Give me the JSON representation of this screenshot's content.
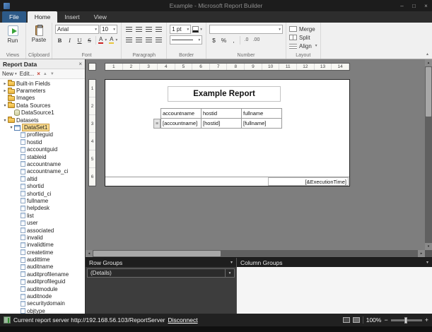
{
  "window": {
    "title": "Example - Microsoft Report Builder"
  },
  "ribbon": {
    "tabs": [
      {
        "label": "File"
      },
      {
        "label": "Home"
      },
      {
        "label": "Insert"
      },
      {
        "label": "View"
      }
    ],
    "views": {
      "label": "Views",
      "run": "Run"
    },
    "clipboard": {
      "label": "Clipboard",
      "paste": "Paste"
    },
    "font": {
      "label": "Font",
      "family": "Arial",
      "size": "10",
      "bold": "B",
      "italic": "I",
      "underline": "U",
      "strike": "S",
      "font_color": "A",
      "highlight": "A"
    },
    "paragraph": {
      "label": "Paragraph"
    },
    "border": {
      "label": "Border",
      "width": "1 pt"
    },
    "number": {
      "label": "Number",
      "currency": "$",
      "percent": "%",
      "comma": ",",
      "dec0": ".0",
      "dec00": ".00"
    },
    "layout": {
      "label": "Layout",
      "merge": "Merge",
      "split": "Split",
      "align": "Align"
    }
  },
  "report_data": {
    "title": "Report Data",
    "toolbar": {
      "new": "New",
      "edit": "Edit..."
    },
    "tree": [
      {
        "label": "Built-in Fields",
        "level": 0,
        "icon": "folder",
        "arrow": "collapsed"
      },
      {
        "label": "Parameters",
        "level": 0,
        "icon": "folder",
        "arrow": "collapsed"
      },
      {
        "label": "Images",
        "level": 0,
        "icon": "folder",
        "arrow": "none"
      },
      {
        "label": "Data Sources",
        "level": 0,
        "icon": "folder",
        "arrow": "expanded"
      },
      {
        "label": "DataSource1",
        "level": 1,
        "icon": "datasource",
        "arrow": "none"
      },
      {
        "label": "Datasets",
        "level": 0,
        "icon": "folder",
        "arrow": "expanded"
      },
      {
        "label": "DataSet1",
        "level": 1,
        "icon": "dataset",
        "arrow": "expanded",
        "selected": true
      },
      {
        "label": "profileguid",
        "level": 2,
        "icon": "field",
        "arrow": "none"
      },
      {
        "label": "hostid",
        "level": 2,
        "icon": "field",
        "arrow": "none"
      },
      {
        "label": "accountguid",
        "level": 2,
        "icon": "field",
        "arrow": "none"
      },
      {
        "label": "stableid",
        "level": 2,
        "icon": "field",
        "arrow": "none"
      },
      {
        "label": "accountname",
        "level": 2,
        "icon": "field",
        "arrow": "none"
      },
      {
        "label": "accountname_ci",
        "level": 2,
        "icon": "field",
        "arrow": "none"
      },
      {
        "label": "altid",
        "level": 2,
        "icon": "field",
        "arrow": "none"
      },
      {
        "label": "shortid",
        "level": 2,
        "icon": "field",
        "arrow": "none"
      },
      {
        "label": "shortid_ci",
        "level": 2,
        "icon": "field",
        "arrow": "none"
      },
      {
        "label": "fullname",
        "level": 2,
        "icon": "field",
        "arrow": "none"
      },
      {
        "label": "helpdesk",
        "level": 2,
        "icon": "field",
        "arrow": "none"
      },
      {
        "label": "list",
        "level": 2,
        "icon": "field",
        "arrow": "none"
      },
      {
        "label": "user",
        "level": 2,
        "icon": "field",
        "arrow": "none"
      },
      {
        "label": "associated",
        "level": 2,
        "icon": "field",
        "arrow": "none"
      },
      {
        "label": "invalid",
        "level": 2,
        "icon": "field",
        "arrow": "none"
      },
      {
        "label": "invalidtime",
        "level": 2,
        "icon": "field",
        "arrow": "none"
      },
      {
        "label": "createtime",
        "level": 2,
        "icon": "field",
        "arrow": "none"
      },
      {
        "label": "audittime",
        "level": 2,
        "icon": "field",
        "arrow": "none"
      },
      {
        "label": "auditname",
        "level": 2,
        "icon": "field",
        "arrow": "none"
      },
      {
        "label": "auditprofilename",
        "level": 2,
        "icon": "field",
        "arrow": "none"
      },
      {
        "label": "auditprofileguid",
        "level": 2,
        "icon": "field",
        "arrow": "none"
      },
      {
        "label": "auditmodule",
        "level": 2,
        "icon": "field",
        "arrow": "none"
      },
      {
        "label": "auditnode",
        "level": 2,
        "icon": "field",
        "arrow": "none"
      },
      {
        "label": "securitydomain",
        "level": 2,
        "icon": "field",
        "arrow": "none"
      },
      {
        "label": "objtype",
        "level": 2,
        "icon": "field",
        "arrow": "none"
      }
    ]
  },
  "design": {
    "ruler_h": [
      "1",
      "2",
      "3",
      "4",
      "5",
      "6",
      "7",
      "8",
      "9",
      "10",
      "11",
      "12",
      "13",
      "14"
    ],
    "ruler_v": [
      "1",
      "2",
      "3",
      "4",
      "5",
      "6"
    ],
    "canvas": {
      "title": "Example Report",
      "table": {
        "headers": [
          "accountname",
          "hostid",
          "fullname"
        ],
        "rows": [
          [
            "[accountname]",
            "[hostid]",
            "[fullname]"
          ]
        ]
      },
      "execution_time": "[&ExecutionTime]"
    }
  },
  "grouping": {
    "row_groups": {
      "title": "Row Groups",
      "items": [
        {
          "label": "(Details)"
        }
      ]
    },
    "column_groups": {
      "title": "Column Groups",
      "items": []
    }
  },
  "status_bar": {
    "server_text": "Current report server http://192.168.56.103/ReportServer",
    "disconnect": "Disconnect",
    "zoom": "100%"
  }
}
